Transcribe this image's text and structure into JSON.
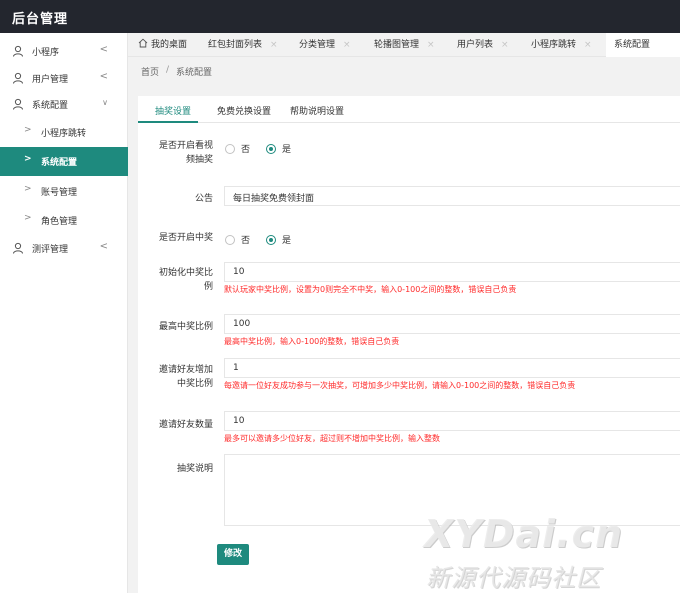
{
  "app": {
    "title": "后台管理"
  },
  "sidebar": {
    "items": [
      {
        "label": "小程序",
        "icon": "user-icon",
        "arrow": "<"
      },
      {
        "label": "用户管理",
        "icon": "user-icon",
        "arrow": "<"
      },
      {
        "label": "系统配置",
        "icon": "user-icon",
        "arrow": "v"
      },
      {
        "label": "小程序跳转",
        "chev": ">"
      },
      {
        "label": "系统配置",
        "chev": ">",
        "active": true
      },
      {
        "label": "账号管理",
        "chev": ">"
      },
      {
        "label": "角色管理",
        "chev": ">"
      },
      {
        "label": "测评管理",
        "icon": "user-icon",
        "arrow": "<"
      }
    ]
  },
  "tabs": [
    {
      "label": "我的桌面",
      "icon": "home-icon"
    },
    {
      "label": "红包封面列表",
      "close": "×"
    },
    {
      "label": "分类管理",
      "close": "×"
    },
    {
      "label": "轮播图管理",
      "close": "×"
    },
    {
      "label": "用户列表",
      "close": "×"
    },
    {
      "label": "小程序跳转",
      "close": "×"
    },
    {
      "label": "系统配置",
      "active": true
    }
  ],
  "breadcrumb": {
    "home": "首页",
    "sep": "/",
    "current": "系统配置"
  },
  "subtabs": [
    "抽奖设置",
    "免费兑换设置",
    "帮助说明设置"
  ],
  "form": {
    "video_lottery": {
      "label": "是否开启看视频抽奖",
      "options": [
        "否",
        "是"
      ],
      "selected": "是"
    },
    "notice": {
      "label": "公告",
      "value": "每日抽奖免费领封面"
    },
    "win_enabled": {
      "label": "是否开启中奖",
      "options": [
        "否",
        "是"
      ],
      "selected": "是"
    },
    "init_ratio": {
      "label": "初始化中奖比例",
      "value": "10",
      "hint": "默认玩家中奖比例，设置为0则完全不中奖，输入0-100之间的整数，错误自己负责"
    },
    "max_ratio": {
      "label": "最高中奖比例",
      "value": "100",
      "hint": "最高中奖比例，输入0-100的整数，错误自己负责"
    },
    "invite_increase": {
      "label": "邀请好友增加中奖比例",
      "value": "1",
      "hint": "每邀请一位好友成功参与一次抽奖，可增加多少中奖比例，请输入0-100之间的整数，错误自己负责"
    },
    "invite_count": {
      "label": "邀请好友数量",
      "value": "10",
      "hint": "最多可以邀请多少位好友，超过则不增加中奖比例，输入整数"
    },
    "lottery_desc": {
      "label": "抽奖说明",
      "value": ""
    },
    "submit_label": "修改"
  },
  "watermark": {
    "line1": "XYDai.cn",
    "line2": "新源代源码社区"
  },
  "colors": {
    "accent": "#1e8a7e",
    "topbar": "#23262e",
    "hint": "#ff2a2a"
  }
}
